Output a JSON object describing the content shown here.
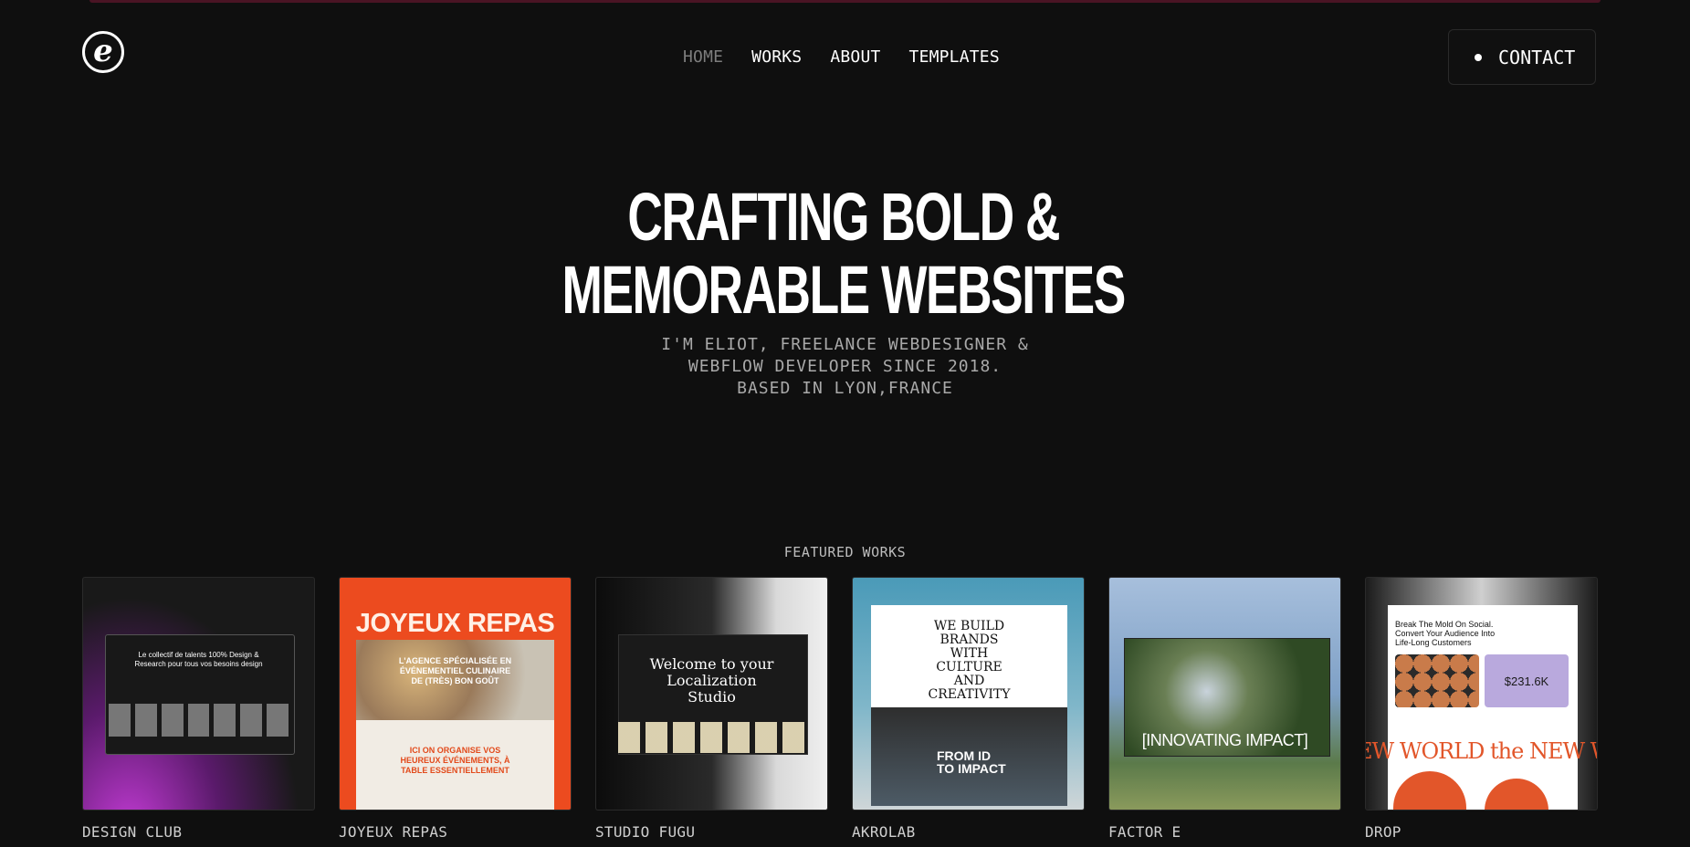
{
  "header": {
    "logo_letter": "e",
    "nav": [
      {
        "label": "HOME",
        "active": true
      },
      {
        "label": "WORKS",
        "active": false
      },
      {
        "label": "ABOUT",
        "active": false
      },
      {
        "label": "TEMPLATES",
        "active": false
      }
    ],
    "contact_label": "CONTACT"
  },
  "hero": {
    "title_lines": [
      "CRAFTING BOLD &",
      "MEMORABLE WEBSITES"
    ],
    "subtitle_lines": [
      "I'M ELIOT, FREELANCE WEBDESIGNER &",
      "WEBFLOW DEVELOPER SINCE 2018.",
      "BASED IN LYON,FRANCE"
    ]
  },
  "featured": {
    "label": "FEATURED WORKS",
    "works": [
      {
        "title": "DESIGN CLUB",
        "thumb_text": "Le collectif de talents 100% Design & Research pour tous vos besoins design"
      },
      {
        "title": "JOYEUX REPAS",
        "thumb_heading": "JOYEUX REPAS",
        "thumb_text": "L'AGENCE SPÉCIALISÉE EN ÉVÉNEMENTIEL CULINAIRE DE (TRÈS) BON GOÛT",
        "thumb_text2": "ICI ON ORGANISE VOS HEUREUX ÉVÉNEMENTS, À TABLE ESSENTIELLEMENT"
      },
      {
        "title": "STUDIO FUGU",
        "thumb_text": "Welcome to your Localization Studio"
      },
      {
        "title": "AKROLAB",
        "thumb_text": "WE BUILD BRANDS WITH CULTURE AND CREATIVITY",
        "thumb_text2": "FROM ID TO IMPACT"
      },
      {
        "title": "FACTOR E",
        "thumb_text": "[INNOVATING IMPACT]"
      },
      {
        "title": "DROP",
        "thumb_text": "Break The Mold On Social. Convert Your Audience Into Life-Long Customers",
        "thumb_price": "$231.6K",
        "thumb_text2": "EW WORLD the NEW W"
      }
    ]
  },
  "colors": {
    "background": "#0f0f0f",
    "nav_active": "#7d7d7d",
    "subtitle": "#a9a9a9"
  }
}
